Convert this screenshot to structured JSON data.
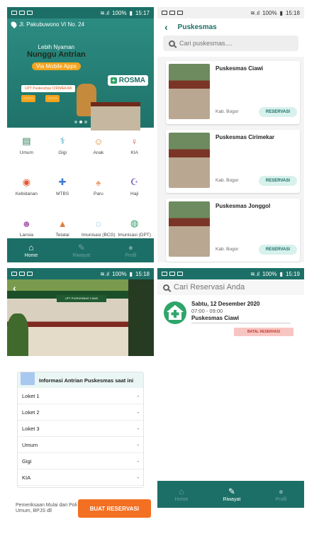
{
  "status": {
    "p1": {
      "battery": "100%",
      "time": "15:17"
    },
    "p2": {
      "battery": "100%",
      "time": "15:18"
    },
    "p3": {
      "battery": "100%",
      "time": "15:18"
    },
    "p4": {
      "battery": "100%",
      "time": "15:19"
    }
  },
  "colors": {
    "primary": "#1c6f66",
    "accent": "#f36f21",
    "cancel": "#f8c6c2"
  },
  "home": {
    "address": "Jl. Pakubuwono VI No. 24",
    "banner": {
      "line1": "Lebih Nyaman",
      "line2": "Nunggu Antrian",
      "line3": "Via Mobile Apps",
      "chip": "UPT Puskesmas CIRIMEKAR",
      "brand": "ROSMA"
    },
    "categories": [
      {
        "label": "Umum",
        "icon": "clinic-icon",
        "glyph": "▤",
        "color": "#2e7d5b"
      },
      {
        "label": "Gigi",
        "icon": "tooth-icon",
        "glyph": "⚕",
        "color": "#3aa6c8"
      },
      {
        "label": "Anak",
        "icon": "child-icon",
        "glyph": "☺",
        "color": "#e08a3c"
      },
      {
        "label": "KIA",
        "icon": "mother-icon",
        "glyph": "♀",
        "color": "#d9534f"
      },
      {
        "label": "Kebidanan",
        "icon": "midwifery-icon",
        "glyph": "◉",
        "color": "#e4572e"
      },
      {
        "label": "MTBS",
        "icon": "mtbs-icon",
        "glyph": "✚",
        "color": "#3a7bd5"
      },
      {
        "label": "Paru",
        "icon": "lungs-icon",
        "glyph": "♠",
        "color": "#f0a070"
      },
      {
        "label": "Haji",
        "icon": "hajj-icon",
        "glyph": "☪",
        "color": "#8a6bc1"
      },
      {
        "label": "Lansia",
        "icon": "elderly-icon",
        "glyph": "☻",
        "color": "#b06ab3"
      },
      {
        "label": "Tetatai",
        "icon": "tetatai-icon",
        "glyph": "▲",
        "color": "#e07b39"
      },
      {
        "label": "Imunisasi (BCG)",
        "icon": "bcg-icon",
        "glyph": "◌",
        "color": "#3aa6c8"
      },
      {
        "label": "Imunisasi (DPT)",
        "icon": "dpt-icon",
        "glyph": "◍",
        "color": "#2e9d6b"
      }
    ],
    "nav": [
      {
        "label": "Home",
        "glyph": "⌂",
        "icon": "home-icon",
        "active": true
      },
      {
        "label": "Riwayat",
        "glyph": "✎",
        "icon": "history-icon",
        "active": false
      },
      {
        "label": "Profil",
        "glyph": "●",
        "icon": "profile-icon",
        "active": false
      }
    ]
  },
  "puskesmas": {
    "title": "Puskesmas",
    "search_placeholder": "Cari puskesmas....",
    "items": [
      {
        "name": "Puskesmas Ciawi",
        "location": "Kab. Bogor",
        "button": "RESERVASI"
      },
      {
        "name": "Puskesmas Cirimekar",
        "location": "Kab. Bogor",
        "button": "RESERVASI"
      },
      {
        "name": "Puskesmas Jonggol",
        "location": "Kab. Bogor",
        "button": "RESERVASI"
      }
    ]
  },
  "detail": {
    "sign": "UPT PUSKESMAS CIAWI",
    "info_title": "Informasi Antrian Puskesmas saat ini",
    "rows": [
      {
        "name": "Loket 1",
        "value": "-"
      },
      {
        "name": "Loket 2",
        "value": "-"
      },
      {
        "name": "Loket 3",
        "value": "-"
      },
      {
        "name": "Umum",
        "value": "-"
      },
      {
        "name": "Gigi",
        "value": "-"
      },
      {
        "name": "KIA",
        "value": "-"
      }
    ],
    "note": "Pemeriksaan Mulai dari Poli Umum, BPJS dll",
    "button": "BUAT RESERVASI"
  },
  "riwayat": {
    "search_placeholder": "Cari Reservasi Anda",
    "booking": {
      "date": "Sabtu, 12 Desember 2020",
      "time": "07:00 - 09:00",
      "place": "Puskesmas Ciawi",
      "cancel": "BATAL RESERVASI"
    },
    "nav": [
      {
        "label": "Home",
        "glyph": "⌂",
        "icon": "home-icon",
        "active": false
      },
      {
        "label": "Riwayat",
        "glyph": "✎",
        "icon": "history-icon",
        "active": true
      },
      {
        "label": "Profil",
        "glyph": "●",
        "icon": "profile-icon",
        "active": false
      }
    ]
  }
}
